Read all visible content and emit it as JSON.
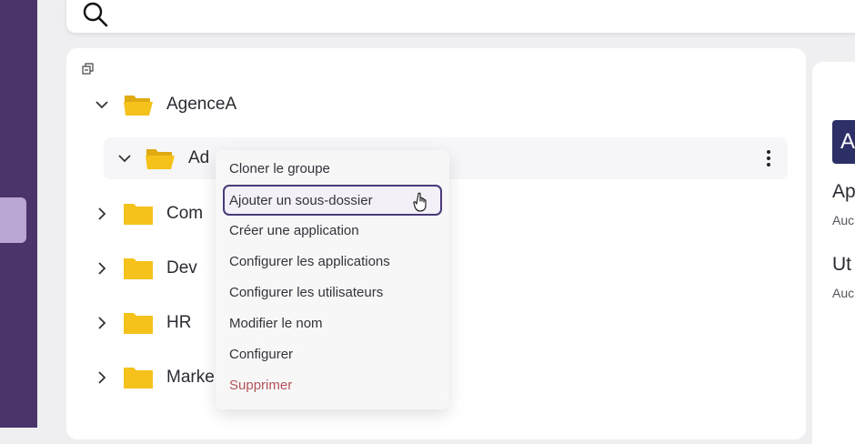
{
  "search": {
    "icon": "search-icon"
  },
  "tree": {
    "nodes": [
      {
        "label": "AgenceA",
        "expanded": true
      },
      {
        "label": "Ad",
        "expanded": true,
        "selected": true
      },
      {
        "label": "Com",
        "expanded": false
      },
      {
        "label": "Dev",
        "expanded": false
      },
      {
        "label": "HR",
        "expanded": false
      },
      {
        "label": "Marke",
        "expanded": false
      }
    ]
  },
  "context_menu": {
    "items": [
      {
        "label": "Cloner le groupe"
      },
      {
        "label": "Ajouter un sous-dossier",
        "highlighted": true
      },
      {
        "label": "Créer une application"
      },
      {
        "label": "Configurer les applications"
      },
      {
        "label": "Configurer les utilisateurs"
      },
      {
        "label": "Modifier le nom"
      },
      {
        "label": "Configurer"
      },
      {
        "label": "Supprimer",
        "danger": true
      }
    ]
  },
  "right_panel": {
    "badge": "A",
    "section1_title": "Ap",
    "section1_sub": "Auc",
    "section2_title": "Ut",
    "section2_sub": "Auc"
  },
  "colors": {
    "sidebar": "#4a3469",
    "folder": "#f5c21b",
    "highlight_border": "#4a3a7a",
    "danger": "#b4545a",
    "badge": "#2d2f67"
  }
}
